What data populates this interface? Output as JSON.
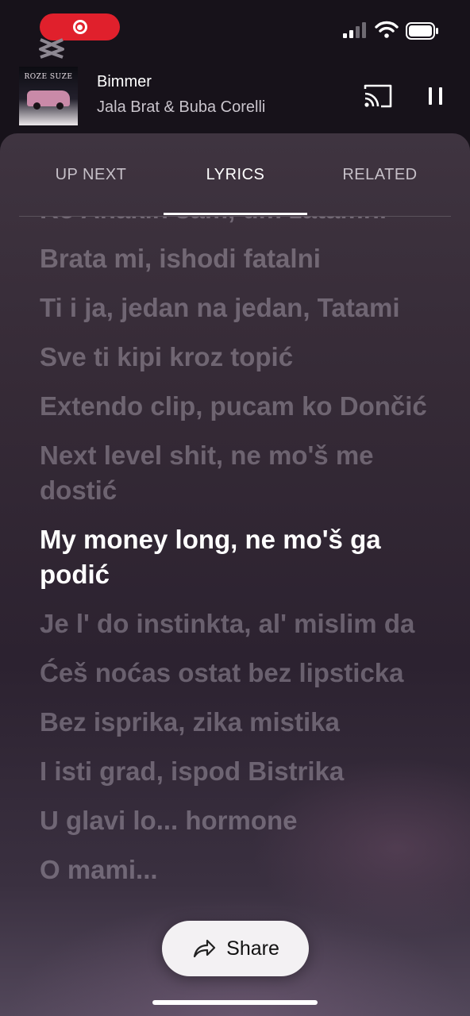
{
  "status_bar": {
    "recording_indicator": "screen-record-icon",
    "icons": [
      "signal-icon",
      "wifi-icon",
      "battery-icon"
    ]
  },
  "now_playing": {
    "album_cover_text": "ROZE SUZE",
    "title": "Bimmer",
    "artist": "Jala Brat & Buba Corelli",
    "playing": true
  },
  "tabs": [
    {
      "label": "UP NEXT",
      "active": false
    },
    {
      "label": "LYRICS",
      "active": true
    },
    {
      "label": "RELATED",
      "active": false
    }
  ],
  "lyrics": [
    {
      "text": "Ko Anakin sam, um zatamni",
      "current": false
    },
    {
      "text": "Brata mi, ishodi fatalni",
      "current": false
    },
    {
      "text": "Ti i ja, jedan na jedan, Tatami",
      "current": false
    },
    {
      "text": "Sve ti kipi kroz topić",
      "current": false
    },
    {
      "text": "Extendo clip, pucam ko Dončić",
      "current": false
    },
    {
      "text": "Next level shit, ne mo'š me dostić",
      "current": false
    },
    {
      "text": "My money long, ne mo'š ga podić",
      "current": true
    },
    {
      "text": "Je l' do instinkta, al' mislim da",
      "current": false
    },
    {
      "text": "Ćeš noćas ostat bez lipsticka",
      "current": false
    },
    {
      "text": "Bez isprika, zika mistika",
      "current": false
    },
    {
      "text": "I isti grad, ispod Bistrika",
      "current": false
    },
    {
      "text": "U glavi lo... hormone",
      "current": false
    },
    {
      "text": "O mami...",
      "current": false
    }
  ],
  "share_button": {
    "label": "Share",
    "icon": "share-arrow-icon"
  },
  "colors": {
    "background": "#17121a",
    "sheet": "#352a36",
    "recording": "#e0202c",
    "share_bg": "#f3f1f3"
  }
}
